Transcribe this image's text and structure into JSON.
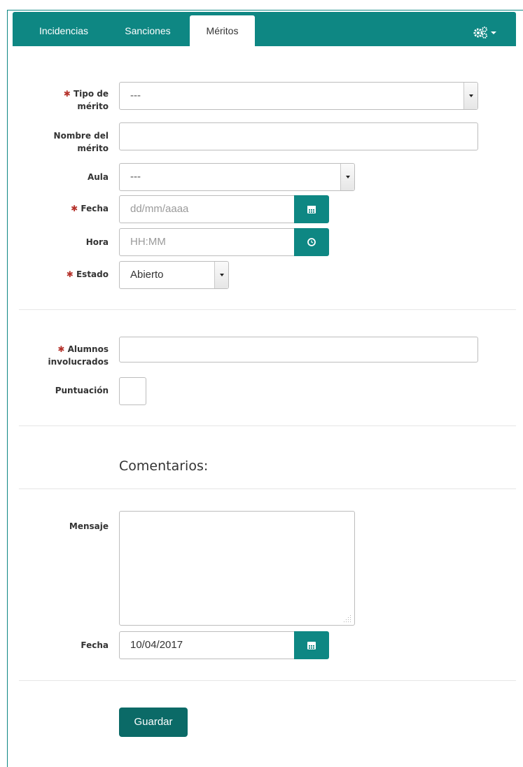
{
  "tabs": [
    {
      "label": "Incidencias",
      "active": false
    },
    {
      "label": "Sanciones",
      "active": false
    },
    {
      "label": "Méritos",
      "active": true
    }
  ],
  "settings_icon": "gears-icon",
  "colors": {
    "accent": "#0e8783",
    "button": "#0b6a67",
    "required": "#b5322b"
  },
  "required_marker": "✱",
  "form": {
    "tipo_merito": {
      "label_1": "Tipo de",
      "label_2": "mérito",
      "value": "---"
    },
    "nombre_merito": {
      "label_1": "Nombre del",
      "label_2": "mérito",
      "value": ""
    },
    "aula": {
      "label": "Aula",
      "value": "---"
    },
    "fecha": {
      "label": "Fecha",
      "placeholder": "dd/mm/aaaa"
    },
    "hora": {
      "label": "Hora",
      "placeholder": "HH:MM"
    },
    "estado": {
      "label": "Estado",
      "value": "Abierto"
    },
    "alumnos": {
      "label_1": "Alumnos",
      "label_2": "involucrados",
      "value": ""
    },
    "puntuacion": {
      "label": "Puntuación",
      "value": ""
    }
  },
  "comentarios": {
    "title": "Comentarios:",
    "mensaje_label": "Mensaje",
    "mensaje_value": "",
    "fecha_label": "Fecha",
    "fecha_value": "10/04/2017"
  },
  "save_button": "Guardar"
}
